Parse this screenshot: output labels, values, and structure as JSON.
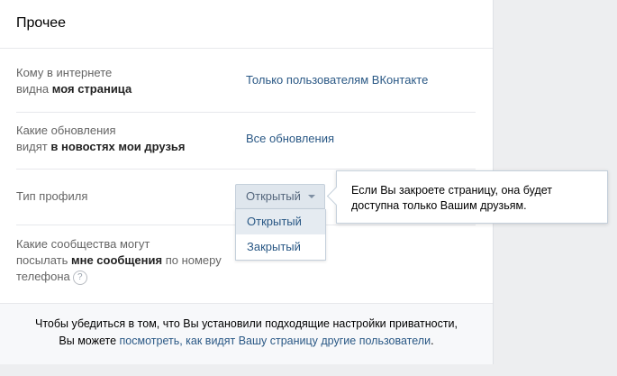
{
  "section": {
    "title": "Прочее"
  },
  "rows": [
    {
      "label_line1": "Кому в интернете",
      "label_line2_pre": "видна ",
      "label_line2_bold": "моя страница",
      "value": "Только пользователям ВКонтакте"
    },
    {
      "label_line1": "Какие обновления",
      "label_line2_pre": "видят ",
      "label_line2_bold": "в новостях мои друзья",
      "value": "Все обновления"
    },
    {
      "label": "Тип профиля"
    },
    {
      "label_line1": "Какие сообщества могут",
      "label_line2_pre": "посылать ",
      "label_line2_bold": "мне сообщения",
      "label_line2_post": " по номеру",
      "label_line3": "телефона",
      "help": "?"
    }
  ],
  "profile_type": {
    "selected": "Открытый",
    "options": [
      "Открытый",
      "Закрытый"
    ]
  },
  "tooltip": {
    "line1": "Если Вы закроете страницу, она будет",
    "line2": "доступна только Вашим друзьям."
  },
  "footer": {
    "line1": "Чтобы убедиться в том, что Вы установили подходящие настройки приватности,",
    "line2_pre": "Вы можете ",
    "line2_link": "посмотреть, как видят Вашу страницу другие пользователи",
    "line2_post": "."
  },
  "colors": {
    "link": "#2a5885",
    "label": "#656565",
    "accent_bg": "#dfe6ed"
  }
}
